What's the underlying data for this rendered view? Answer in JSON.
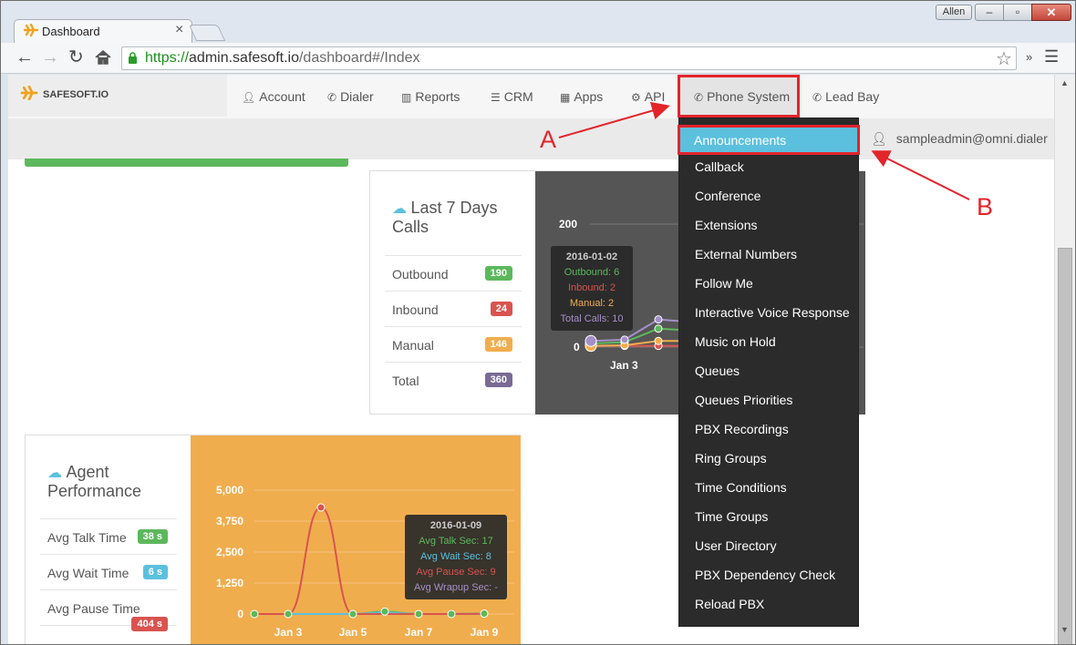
{
  "browser": {
    "tab_title": "Dashboard",
    "user_badge": "Allen",
    "url_scheme": "https://",
    "url_host": "admin.safesoft.io",
    "url_path": "/dashboard#/Index",
    "ext_chevrons": "»"
  },
  "nav": {
    "brand": "SAFESOFT.IO",
    "items": [
      {
        "label": "Account",
        "icon": "user-icon"
      },
      {
        "label": "Dialer",
        "icon": "phone-icon"
      },
      {
        "label": "Reports",
        "icon": "bar-chart-icon"
      },
      {
        "label": "CRM",
        "icon": "list-icon"
      },
      {
        "label": "Apps",
        "icon": "grid-icon"
      },
      {
        "label": "API",
        "icon": "gear-icon"
      },
      {
        "label": "Phone System",
        "icon": "phone-icon"
      },
      {
        "label": "Lead Bay",
        "icon": "phone-icon"
      }
    ],
    "account_email": "sampleadmin@omni.dialer"
  },
  "dropdown": {
    "items": [
      "Announcements",
      "Callback",
      "Conference",
      "Extensions",
      "External Numbers",
      "Follow Me",
      "Interactive Voice Response",
      "Music on Hold",
      "Queues",
      "Queues Priorities",
      "PBX Recordings",
      "Ring Groups",
      "Time Conditions",
      "Time Groups",
      "User Directory",
      "PBX Dependency Check",
      "Reload PBX"
    ]
  },
  "annotations": {
    "a": "A",
    "b": "B"
  },
  "calls_panel": {
    "title_line1": "Last 7 Days",
    "title_line2": "Calls",
    "stats": [
      {
        "label": "Outbound",
        "value": "190",
        "color": "#5cb85c"
      },
      {
        "label": "Inbound",
        "value": "24",
        "color": "#d9534f"
      },
      {
        "label": "Manual",
        "value": "146",
        "color": "#f0ad4e"
      },
      {
        "label": "Total",
        "value": "360",
        "color": "#7a6a94"
      }
    ],
    "tooltip": {
      "date": "2016-01-02",
      "lines": [
        "Outbound: 6",
        "Inbound: 2",
        "Manual: 2",
        "Total Calls: 10"
      ]
    }
  },
  "agent_panel": {
    "title_line1": "Agent",
    "title_line2": "Performance",
    "stats": [
      {
        "label": "Avg Talk Time",
        "value": "38 s",
        "color": "#5cb85c"
      },
      {
        "label": "Avg Wait Time",
        "value": "6 s",
        "color": "#5bc0de"
      },
      {
        "label": "Avg Pause Time",
        "value": "404 s",
        "color": "#d9534f"
      }
    ],
    "tooltip": {
      "date": "2016-01-09",
      "lines": [
        "Avg Talk Sec: 17",
        "Avg Wait Sec: 8",
        "Avg Pause Sec: 9",
        "Avg Wrapup Sec: -"
      ]
    }
  },
  "chart_data": [
    {
      "type": "line",
      "yticks": [
        "200",
        "0"
      ],
      "xticks": [
        "Jan 3"
      ],
      "ylim": [
        0,
        200
      ],
      "series": [
        {
          "name": "Outbound",
          "color": "#5cb85c",
          "x": [
            "2016-01-02",
            "2016-01-03",
            "2016-01-04",
            "2016-01-05"
          ],
          "values": [
            6,
            8,
            30,
            28
          ]
        },
        {
          "name": "Inbound",
          "color": "#d9534f",
          "x": [
            "2016-01-02",
            "2016-01-03",
            "2016-01-04",
            "2016-01-05"
          ],
          "values": [
            2,
            2,
            2,
            2
          ]
        },
        {
          "name": "Manual",
          "color": "#f0ad4e",
          "x": [
            "2016-01-02",
            "2016-01-03",
            "2016-01-04",
            "2016-01-05"
          ],
          "values": [
            2,
            3,
            10,
            10
          ]
        },
        {
          "name": "Total Calls",
          "color": "#a48fc8",
          "x": [
            "2016-01-02",
            "2016-01-03",
            "2016-01-04",
            "2016-01-05"
          ],
          "values": [
            10,
            12,
            45,
            42
          ]
        }
      ]
    },
    {
      "type": "line",
      "yticks": [
        "5,000",
        "3,750",
        "2,500",
        "1,250",
        "0"
      ],
      "xticks": [
        "Jan 3",
        "Jan 5",
        "Jan 7",
        "Jan 9"
      ],
      "ylim": [
        0,
        5000
      ],
      "x": [
        "2016-01-02",
        "2016-01-03",
        "2016-01-04",
        "2016-01-05",
        "2016-01-06",
        "2016-01-07",
        "2016-01-08",
        "2016-01-09"
      ],
      "series": [
        {
          "name": "Avg Talk Sec",
          "color": "#5cb85c",
          "values": [
            0,
            0,
            0,
            0,
            100,
            0,
            0,
            17
          ]
        },
        {
          "name": "Avg Wait Sec",
          "color": "#5bc0de",
          "values": [
            0,
            0,
            0,
            0,
            60,
            0,
            0,
            8
          ]
        },
        {
          "name": "Avg Pause Sec",
          "color": "#d9534f",
          "values": [
            0,
            0,
            4300,
            0,
            0,
            0,
            0,
            9
          ]
        }
      ]
    }
  ]
}
